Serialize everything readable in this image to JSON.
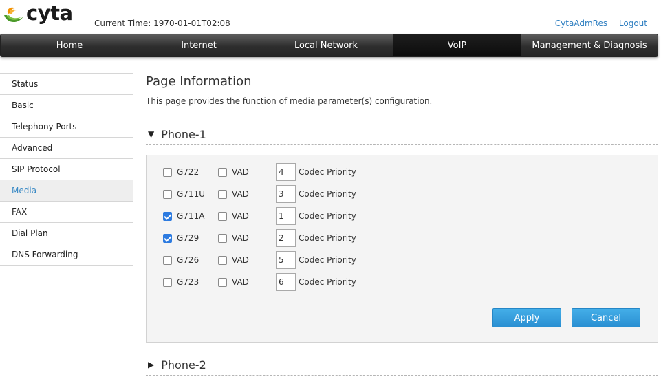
{
  "header": {
    "brand": "cyta",
    "current_time_label": "Current Time:",
    "current_time_value": "1970-01-01T02:08",
    "user_link": "CytaAdmRes",
    "logout_link": "Logout"
  },
  "nav": {
    "items": [
      {
        "label": "Home"
      },
      {
        "label": "Internet"
      },
      {
        "label": "Local Network"
      },
      {
        "label": "VoIP"
      },
      {
        "label": "Management & Diagnosis"
      }
    ],
    "active": "VoIP"
  },
  "sidebar": {
    "items": [
      {
        "label": "Status"
      },
      {
        "label": "Basic"
      },
      {
        "label": "Telephony Ports"
      },
      {
        "label": "Advanced"
      },
      {
        "label": "SIP Protocol"
      },
      {
        "label": "Media"
      },
      {
        "label": "FAX"
      },
      {
        "label": "Dial Plan"
      },
      {
        "label": "DNS Forwarding"
      }
    ],
    "active": "Media"
  },
  "main": {
    "title": "Page Information",
    "description": "This page provides the function of media parameter(s) configuration.",
    "phone1": {
      "label": "Phone-1",
      "expanded": true,
      "codecs": [
        {
          "name": "G722",
          "enabled": false,
          "vad_label": "VAD",
          "vad": false,
          "priority": "4",
          "priority_label": "Codec Priority"
        },
        {
          "name": "G711U",
          "enabled": false,
          "vad_label": "VAD",
          "vad": false,
          "priority": "3",
          "priority_label": "Codec Priority"
        },
        {
          "name": "G711A",
          "enabled": true,
          "vad_label": "VAD",
          "vad": false,
          "priority": "1",
          "priority_label": "Codec Priority"
        },
        {
          "name": "G729",
          "enabled": true,
          "vad_label": "VAD",
          "vad": false,
          "priority": "2",
          "priority_label": "Codec Priority"
        },
        {
          "name": "G726",
          "enabled": false,
          "vad_label": "VAD",
          "vad": false,
          "priority": "5",
          "priority_label": "Codec Priority"
        },
        {
          "name": "G723",
          "enabled": false,
          "vad_label": "VAD",
          "vad": false,
          "priority": "6",
          "priority_label": "Codec Priority"
        }
      ],
      "apply_label": "Apply",
      "cancel_label": "Cancel"
    },
    "phone2": {
      "label": "Phone-2",
      "expanded": false
    }
  },
  "colors": {
    "link": "#2f7fc1",
    "active_sidebar_text": "#3a8ac5",
    "button": "#2a8fd2",
    "checkbox_checked": "#2d7be0"
  }
}
